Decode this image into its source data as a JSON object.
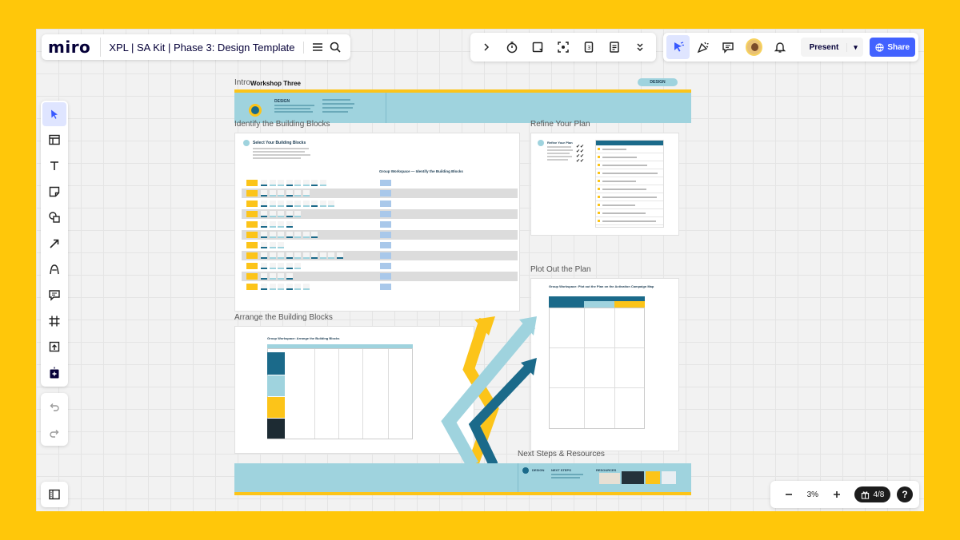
{
  "app": {
    "logo": "miro",
    "board_title": "XPL | SA Kit | Phase 3: Design Template"
  },
  "topbar": {
    "present_label": "Present",
    "share_label": "Share"
  },
  "zoom": {
    "level": "3%",
    "page": "4/8"
  },
  "help_label": "?",
  "frames": {
    "intro": "Intro",
    "workshop": "Workshop Three",
    "design_badge": "DESIGN",
    "identify": "Identify the Building Blocks",
    "refine": "Refine Your Plan",
    "plot": "Plot Out the Plan",
    "arrange": "Arrange the Building Blocks",
    "next": "Next Steps & Resources"
  },
  "mini": {
    "select_blocks": "Select Your Building Blocks",
    "group_identify": "Group Workspace — Identify the Building Blocks",
    "refine_title": "Refine Your Plan",
    "group_plot": "Group Workspace: Plot out the Plan on the Activation Campaign Map",
    "group_arrange": "Group Workspace: Arrange the Building Blocks",
    "design": "DESIGN",
    "next_steps": "NEXT STEPS",
    "resources": "RESOURCES"
  },
  "colors": {
    "accent": "#4262ff",
    "teal": "#9fd3de",
    "yellow": "#fcc419",
    "navy": "#1b6a8a",
    "frame_bg": "#ffc70a"
  },
  "icons": [
    "chevron-right-icon",
    "timer-icon",
    "sticky-add-icon",
    "focus-icon",
    "card-icon",
    "notes-icon",
    "more-chevrons-icon",
    "cursor-icon",
    "celebrate-icon",
    "comment-icon",
    "bell-icon",
    "globe-icon",
    "select-icon",
    "template-icon",
    "text-icon",
    "sticky-note-icon",
    "shapes-icon",
    "arrow-icon",
    "pen-icon",
    "comment-tool-icon",
    "frame-icon",
    "upload-icon",
    "add-apps-icon",
    "undo-icon",
    "redo-icon",
    "panel-icon",
    "minus-icon",
    "plus-icon",
    "gift-icon"
  ]
}
